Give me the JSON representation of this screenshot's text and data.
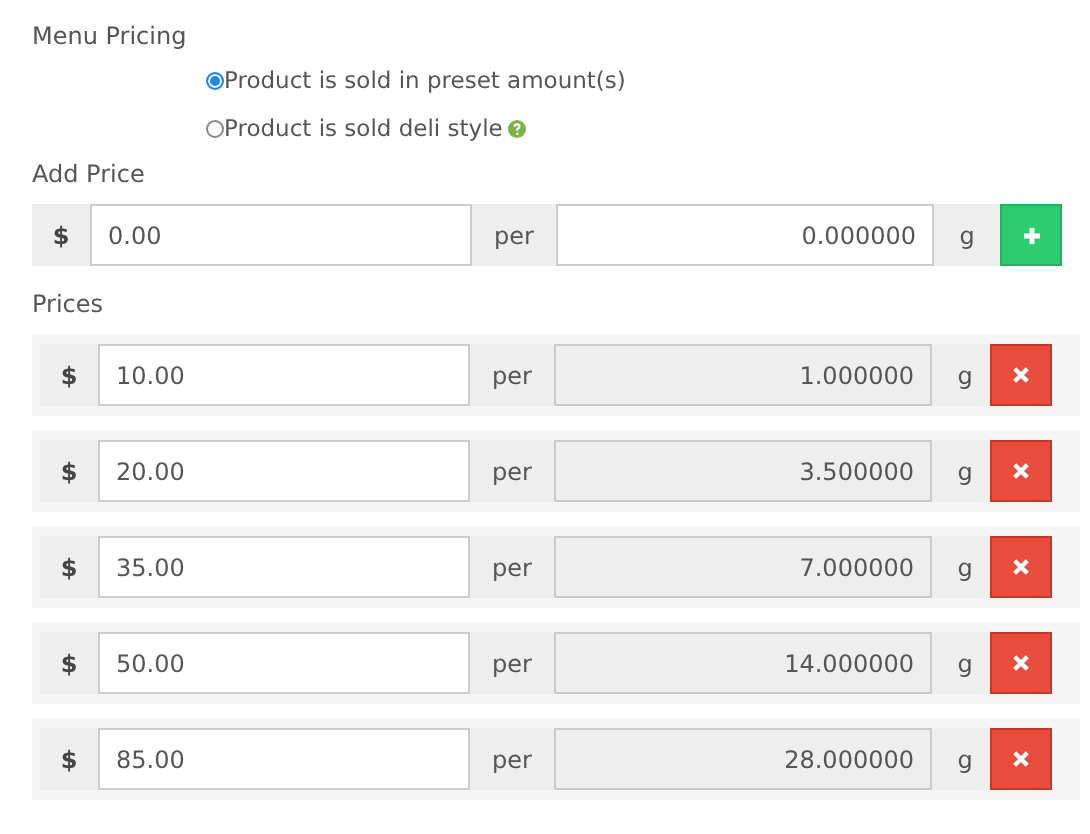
{
  "heading": "Menu Pricing",
  "options": [
    {
      "label": "Product is sold in preset amount(s)",
      "selected": true,
      "help": false
    },
    {
      "label": "Product is sold deli style",
      "selected": false,
      "help": true
    }
  ],
  "add_price": {
    "label": "Add Price",
    "currency": "$",
    "price": "0.00",
    "per": "per",
    "amount": "0.000000",
    "unit": "g"
  },
  "prices_label": "Prices",
  "prices": [
    {
      "currency": "$",
      "price": "10.00",
      "per": "per",
      "amount": "1.000000",
      "unit": "g"
    },
    {
      "currency": "$",
      "price": "20.00",
      "per": "per",
      "amount": "3.500000",
      "unit": "g"
    },
    {
      "currency": "$",
      "price": "35.00",
      "per": "per",
      "amount": "7.000000",
      "unit": "g"
    },
    {
      "currency": "$",
      "price": "50.00",
      "per": "per",
      "amount": "14.000000",
      "unit": "g"
    },
    {
      "currency": "$",
      "price": "85.00",
      "per": "per",
      "amount": "28.000000",
      "unit": "g"
    }
  ]
}
